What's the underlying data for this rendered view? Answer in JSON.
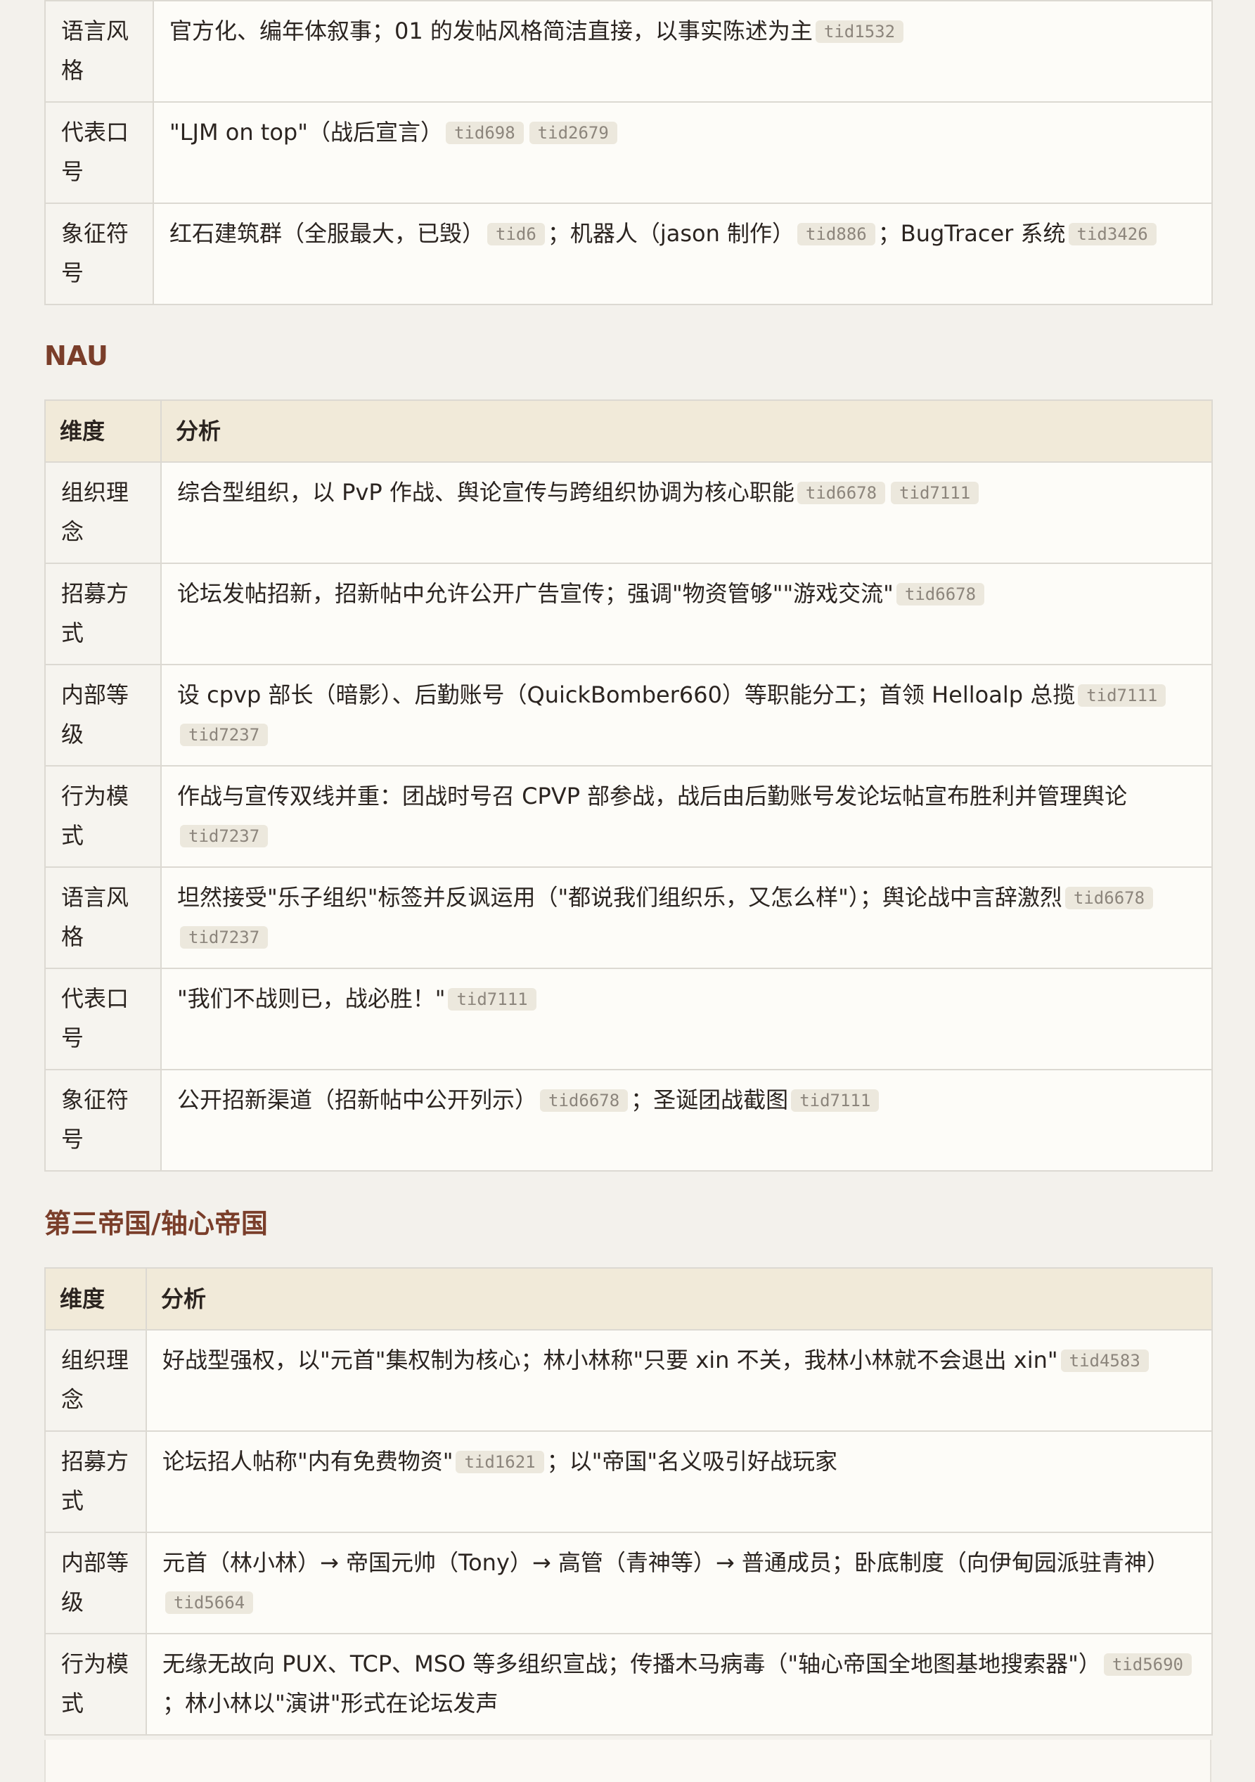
{
  "table1": {
    "rows": [
      {
        "label": "语言风格",
        "text": "官方化、编年体叙事；01 的发帖风格简洁直接，以事实陈述为主",
        "tids": [
          "tid1532"
        ]
      },
      {
        "label": "代表口号",
        "text": "\"LJM on top\"（战后宣言）",
        "tids": [
          "tid698",
          "tid2679"
        ]
      },
      {
        "label": "象征符号",
        "segments": [
          {
            "text": "红石建筑群（全服最大，已毁）",
            "tids": [
              "tid6"
            ]
          },
          {
            "text": "；机器人（jason 制作）",
            "tids": [
              "tid886"
            ]
          },
          {
            "text": "；BugTracer 系统",
            "tids": [
              "tid3426"
            ]
          }
        ]
      }
    ]
  },
  "nau": {
    "heading": "NAU",
    "header": {
      "col1": "维度",
      "col2": "分析"
    },
    "rows": [
      {
        "label": "组织理念",
        "text": "综合型组织，以 PvP 作战、舆论宣传与跨组织协调为核心职能",
        "tids": [
          "tid6678",
          "tid7111"
        ]
      },
      {
        "label": "招募方式",
        "text": "论坛发帖招新，招新帖中允许公开广告宣传；强调\"物资管够\"\"游戏交流\"",
        "tids": [
          "tid6678"
        ]
      },
      {
        "label": "内部等级",
        "text": "设 cpvp 部长（暗影）、后勤账号（QuickBomber660）等职能分工；首领 Helloalp 总揽",
        "tids": [
          "tid7111",
          "tid7237"
        ]
      },
      {
        "label": "行为模式",
        "text": "作战与宣传双线并重：团战时号召 CPVP 部参战，战后由后勤账号发论坛帖宣布胜利并管理舆论",
        "tids": [
          "tid7237"
        ]
      },
      {
        "label": "语言风格",
        "text": "坦然接受\"乐子组织\"标签并反讽运用（\"都说我们组织乐，又怎么样\"）；舆论战中言辞激烈",
        "tids": [
          "tid6678",
          "tid7237"
        ]
      },
      {
        "label": "代表口号",
        "text": "\"我们不战则已，战必胜！\"",
        "tids": [
          "tid7111"
        ]
      },
      {
        "label": "象征符号",
        "segments": [
          {
            "text": "公开招新渠道（招新帖中公开列示）",
            "tids": [
              "tid6678"
            ]
          },
          {
            "text": "；圣诞团战截图",
            "tids": [
              "tid7111"
            ]
          }
        ]
      }
    ]
  },
  "reich": {
    "heading": "第三帝国/轴心帝国",
    "header": {
      "col1": "维度",
      "col2": "分析"
    },
    "rows": [
      {
        "label": "组织理念",
        "text": "好战型强权，以\"元首\"集权制为核心；林小林称\"只要 xin 不关，我林小林就不会退出 xin\"",
        "tids": [
          "tid4583"
        ]
      },
      {
        "label": "招募方式",
        "segments": [
          {
            "text": "论坛招人帖称\"内有免费物资\"",
            "tids": [
              "tid1621"
            ]
          },
          {
            "text": "；以\"帝国\"名义吸引好战玩家",
            "tids": []
          }
        ]
      },
      {
        "label": "内部等级",
        "text": "元首（林小林）→ 帝国元帅（Tony）→ 高管（青神等）→ 普通成员；卧底制度（向伊甸园派驻青神）",
        "tids": [
          "tid5664"
        ]
      },
      {
        "label": "行为模式",
        "segments": [
          {
            "text": "无缘无故向 PUX、TCP、MSO 等多组织宣战；传播木马病毒（\"轴心帝国全地图基地搜索器\"）",
            "tids": [
              "tid5690"
            ]
          },
          {
            "text": "；林小林以\"演讲\"形式在论坛发声",
            "tids": []
          }
        ]
      }
    ]
  }
}
